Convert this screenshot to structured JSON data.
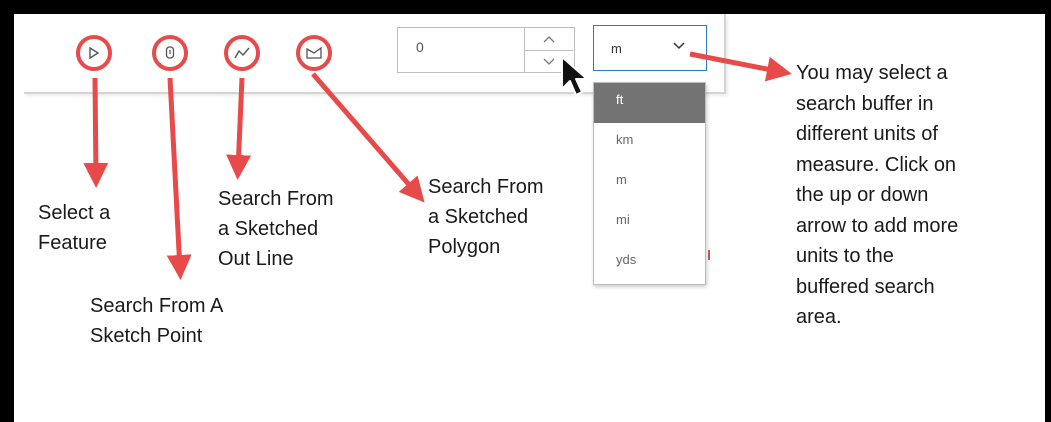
{
  "toolbar": {
    "tools": [
      {
        "name": "select-feature",
        "icon": "cursor-arrow-icon"
      },
      {
        "name": "sketch-point",
        "icon": "map-pin-icon"
      },
      {
        "name": "sketch-line",
        "icon": "polyline-icon"
      },
      {
        "name": "sketch-polygon",
        "icon": "polygon-icon"
      }
    ],
    "buffer_distance": "0",
    "unit_selected": "m",
    "unit_options": [
      "ft",
      "km",
      "m",
      "mi",
      "yds"
    ],
    "highlighted_option": "ft"
  },
  "annotations": {
    "select_feature": [
      "Select a",
      "Feature"
    ],
    "sketch_point": [
      "Search From A",
      "Sketch Point"
    ],
    "sketch_line": [
      "Search From",
      "a Sketched",
      "Out Line"
    ],
    "sketch_polygon": [
      "Search From",
      "a Sketched",
      "Polygon"
    ],
    "units_note": [
      "You may select a",
      "search buffer in",
      "different units of",
      "measure. Click on",
      "the up or down",
      "arrow to add more",
      "units to the",
      "buffered search",
      "area."
    ]
  },
  "colors": {
    "callout": "#e84a4a",
    "select_border": "#2b79c2",
    "highlight": "#737373",
    "frame": "#000000"
  }
}
